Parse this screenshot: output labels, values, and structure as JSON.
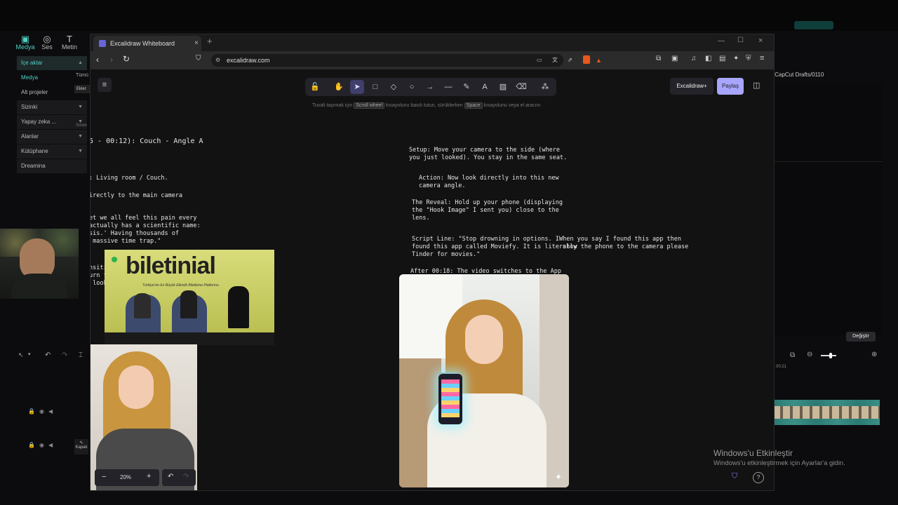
{
  "capcut": {
    "toolbar": [
      {
        "icon": "media-icon",
        "label": "Medya"
      },
      {
        "icon": "audio-icon",
        "label": "Ses"
      },
      {
        "icon": "text-icon",
        "label": "Metin"
      }
    ],
    "sidebar": [
      {
        "label": "İçe aktar",
        "active": true
      },
      {
        "label": "Medya",
        "active": false
      },
      {
        "label": "Alt projeler",
        "active": false
      },
      {
        "label": "Sizinki",
        "dropdown": true
      },
      {
        "label": "Yapay zeka ...",
        "dropdown": true
      },
      {
        "label": "Alanlar",
        "dropdown": true
      },
      {
        "label": "Kütüphane",
        "dropdown": true
      },
      {
        "label": "Dreamina",
        "dropdown": false
      }
    ],
    "tab_all": "Tümü",
    "add_label": "Ekler",
    "screen_label": "Scree",
    "cover_label": "Kapak",
    "drafts_path": "/CapCut Drafts/0110",
    "change_button": "Değiştir",
    "timecode": "00:21"
  },
  "browser": {
    "tab_title": "Excalidraw Whiteboard",
    "url": "excalidraw.com",
    "badge_count": "2"
  },
  "excalidraw": {
    "hint": {
      "prefix": "Tuvali taşımak için",
      "key1": "Scroll wheel",
      "middle": "kısayolunu basılı tutun, sürüklerken",
      "key2": "Space",
      "suffix": "kısayolunu veya el aracını"
    },
    "excalidraw_plus": "Excalidraw+",
    "share": "Paylaş",
    "zoom": "20%",
    "left_notes": [
      "5 - 00:12): Couch - Angle A",
      ": Living room / Couch.",
      "irectly to the main camera",
      "et we all feel this pain every\nactually has a scientific name:\nsis.' Having thousands of\n massive time trap.\"",
      "nsiti\nurn t\n look"
    ],
    "center_notes": {
      "setup": "Setup: Move your camera to the side (where\nyou just looked). You stay in the same seat.",
      "action": "Action: Now look directly into this new\ncamera angle.",
      "reveal": "The Reveal: Hold up your phone (displaying\nthe \"Hook Image\" I sent you) close to the\nlens.",
      "script": "Script Line: \"Stop drowning in options. I\nfound this app called Moviefy. It is literally\nTinder for movies.\"",
      "after": "After 00:18: The video switches to the App\nRecording (Bubble/PiP style), so just\ncontinue delivering the rest of the script\nlooking at the camera.",
      "side": "When you say I found this app then\n show the phone to the camera please"
    },
    "banner": {
      "brand": "biletinial",
      "tagline": "Türkiye'nin En Büyük Etkinlik Biletleme Platformu"
    }
  },
  "windows": {
    "activate_title": "Windows'u Etkinleştir",
    "activate_sub": "Windows'u etkinleştirmek için Ayarlar'a gidin."
  }
}
